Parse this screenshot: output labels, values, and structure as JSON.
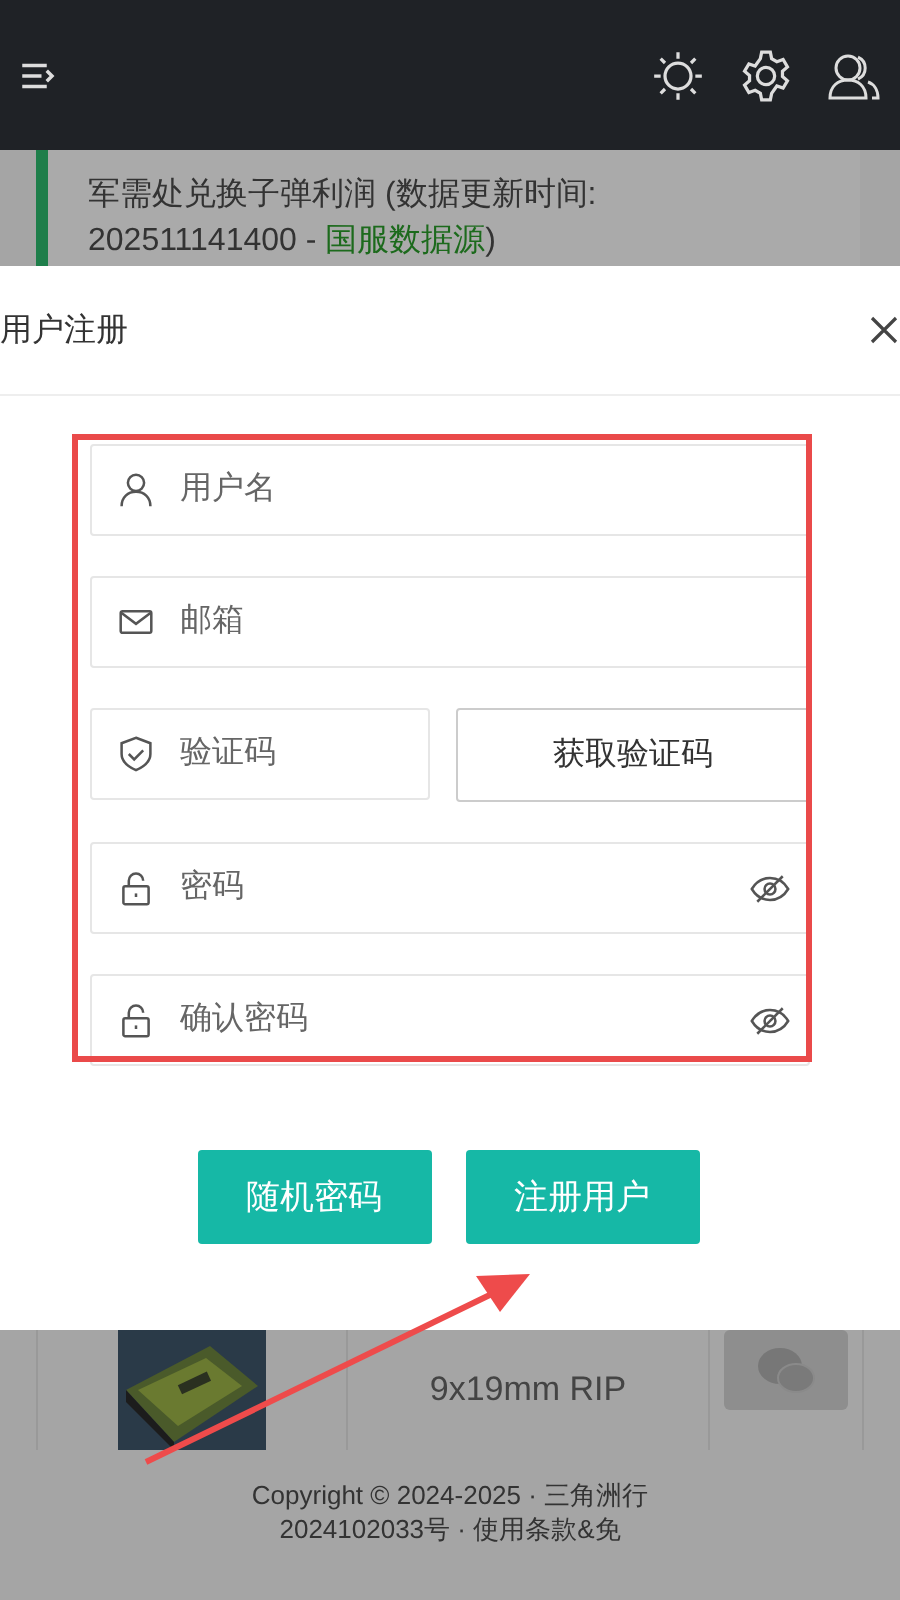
{
  "notice": {
    "line1": "军需处兑换子弹利润 (数据更新时间:",
    "text": "202511141400 - ",
    "link": "国服数据源",
    "tail": ")"
  },
  "table_row": {
    "name": "9x19mm RIP"
  },
  "footer": [
    "Copyright © 2024-2025 · 三角洲行",
    "2024102033号 · 使用条款&免"
  ],
  "dialog": {
    "title": "用户注册",
    "fields": [
      {
        "kind": "user",
        "placeholder": "用户名"
      },
      {
        "kind": "email",
        "placeholder": "邮箱"
      },
      {
        "kind": "code",
        "placeholder": "验证码",
        "button": "获取验证码"
      },
      {
        "kind": "password",
        "placeholder": "密码"
      },
      {
        "kind": "password",
        "placeholder": "确认密码"
      }
    ],
    "buttons": [
      "随机密码",
      "注册用户"
    ]
  }
}
